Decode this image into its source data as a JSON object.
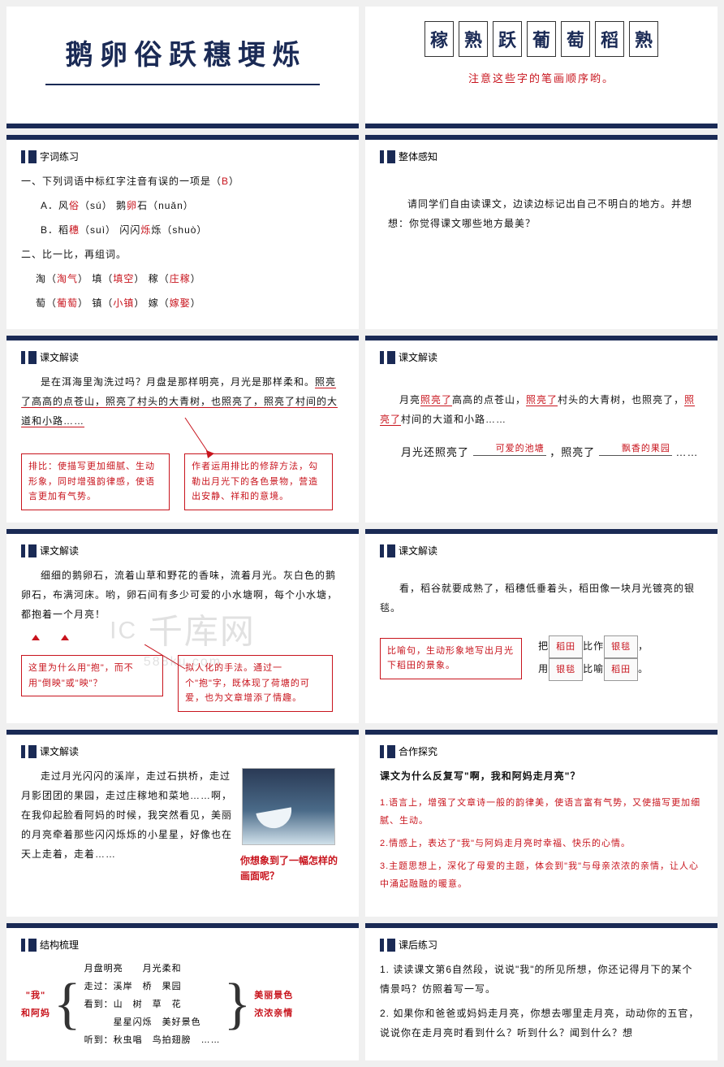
{
  "watermark": {
    "main": "千库网",
    "sub": "588ku.com",
    "icon": "IC"
  },
  "s1": {
    "chars": "鹅 卵 俗 跃 穗 埂 烁"
  },
  "s2": {
    "chars": [
      "稼",
      "熟",
      "跃",
      "葡",
      "萄",
      "稻",
      "熟"
    ],
    "note": "注意这些字的笔画顺序哟。"
  },
  "s3": {
    "title": "字词练习",
    "q1": {
      "stem_a": "一、下列词语中标红字注音有误的一项是（",
      "ans": "B",
      "stem_b": "）"
    },
    "opts": {
      "A_pre": "A．风",
      "A_r": "俗",
      "A_py": "（sú）   鹅",
      "A_r2": "卵",
      "A_py2": "石（nuǎn）",
      "B_pre": "B．稻",
      "B_r": "穗",
      "B_py": "（suì）  闪闪",
      "B_r2": "烁",
      "B_py2": "烁（shuò）"
    },
    "q2": "二、比一比，再组词。",
    "rows": [
      {
        "a": "淘（",
        "av": "淘气",
        "b": "）   填（",
        "bv": "填空",
        "c": "）   稼（",
        "cv": "庄稼",
        "d": "）"
      },
      {
        "a": "萄（",
        "av": "葡萄",
        "b": "）   镇（",
        "bv": "小镇",
        "c": "）   嫁（",
        "cv": "嫁娶",
        "d": "）"
      }
    ]
  },
  "s4": {
    "title": "整体感知",
    "text": "请同学们自由读课文，边读边标记出自己不明白的地方。并想想：你觉得课文哪些地方最美？"
  },
  "s5": {
    "title": "课文解读",
    "p1a": "是在洱海里淘洗过吗？月盘是那样明亮，月光是那样柔和。",
    "p1b": "照亮了高高的点苍山，照亮了村头的大青树，也照亮了，照亮了村间的大道和小路……",
    "box1": "排比：使描写更加细腻、生动形象，同时增强韵律感，使语言更加有气势。",
    "box2": "作者运用排比的修辞方法，勾勒出月光下的各色景物，营造出安静、祥和的意境。"
  },
  "s6": {
    "title": "课文解读",
    "line_a": "月亮",
    "hl": "照亮了",
    "line_b": "高高的点苍山，",
    "line_c": "村头的大青树，也照亮了，",
    "line_d": "村间的大道和小路……",
    "q_pre": "月光还照亮了",
    "fill1": "可爱的池塘",
    "mid": "，照亮了",
    "fill2": "飘香的果园",
    "tail": " ……"
  },
  "s7": {
    "title": "课文解读",
    "p": "细细的鹅卵石，流着山草和野花的香味，流着月光。灰白色的鹅卵石，布满河床。哟，卵石间有多少可爱的小水塘啊，每个小水塘，都抱着一个月亮！",
    "box1": "这里为什么用\"抱\"，而不用\"倒映\"或\"映\"？",
    "box2": "拟人化的手法。通过一个\"抱\"字，既体现了荷塘的可爱，也为文章增添了情趣。"
  },
  "s8": {
    "title": "课文解读",
    "p": "看，稻谷就要成熟了，稻穗低垂着头，稻田像一块月光镀亮的银毯。",
    "box": "比喻句，生动形象地写出月光下稻田的景象。",
    "r1a": "把",
    "r1v": "稻田",
    "r1b": "比作",
    "r1v2": "银毯",
    "r1c": "，",
    "r2a": "用",
    "r2v": "银毯",
    "r2b": "比喻",
    "r2v2": "稻田",
    "r2c": "。"
  },
  "s9": {
    "title": "课文解读",
    "p": "走过月光闪闪的溪岸，走过石拱桥，走过月影团团的果园，走过庄稼地和菜地……啊，在我仰起脸看阿妈的时候，我突然看见，美丽的月亮牵着那些闪闪烁烁的小星星，好像也在天上走着，走着……",
    "q": "你想象到了一幅怎样的画面呢？"
  },
  "s10": {
    "title": "合作探究",
    "q": "课文为什么反复写\"啊，我和阿妈走月亮\"？",
    "a1": "1.语言上，增强了文章诗一般的韵律美，使语言富有气势，又使描写更加细腻、生动。",
    "a2": "2.情感上，表达了\"我\"与阿妈走月亮时幸福、快乐的心情。",
    "a3": "3.主题思想上，深化了母爱的主题，体会到\"我\"与母亲浓浓的亲情，让人心中涌起融融的暖意。"
  },
  "s11": {
    "title": "结构梳理",
    "left": "\"我\"\n和阿妈",
    "mids": [
      "月盘明亮　　月光柔和",
      "走过：溪岸　桥　果园",
      "看到：山　树　草　花\n　　　星星闪烁　美好景色",
      "听到：秋虫唱　鸟拍翅膀　……"
    ],
    "right": "美丽景色\n浓浓亲情"
  },
  "s12": {
    "title": "课后练习",
    "q1": "1. 读读课文第6自然段，说说\"我\"的所见所想，你还记得月下的某个情景吗？仿照着写一写。",
    "q2": "2. 如果你和爸爸或妈妈走月亮，你想去哪里走月亮，动动你的五官，说说你在走月亮时看到什么？听到什么？闻到什么？想"
  }
}
